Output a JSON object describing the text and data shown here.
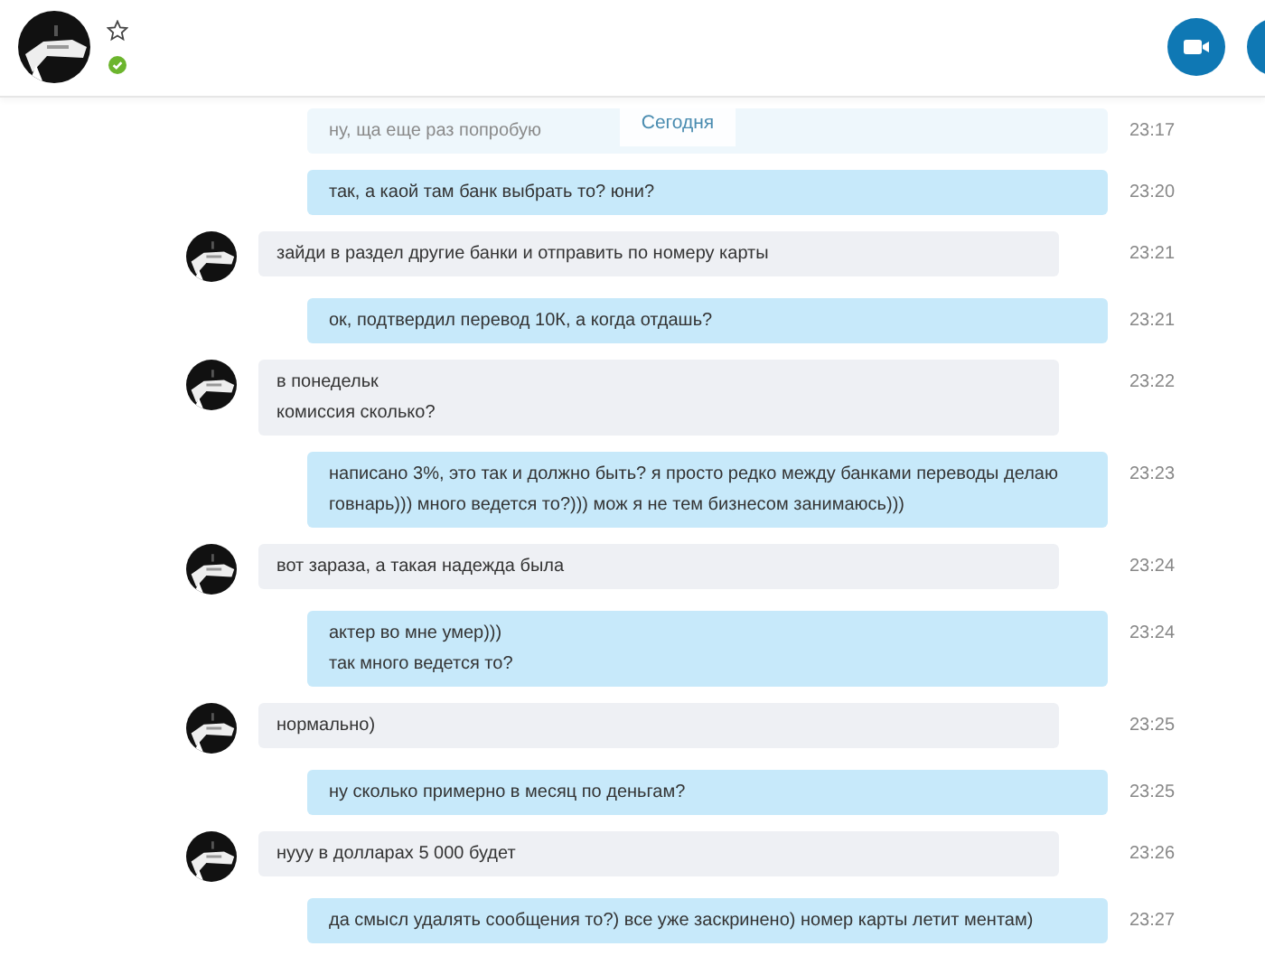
{
  "header": {
    "favorite": false,
    "online": true
  },
  "date_label": "Сегодня",
  "messages": [
    {
      "kind": "outgoing",
      "faded": true,
      "lines": [
        "ну, ща еще раз попробую"
      ],
      "time": "23:17"
    },
    {
      "kind": "outgoing",
      "faded": false,
      "lines": [
        "так, а каой там банк выбрать то? юни?"
      ],
      "time": "23:20"
    },
    {
      "kind": "incoming",
      "faded": false,
      "lines": [
        "зайди в раздел другие банки и отправить по номеру карты"
      ],
      "time": "23:21"
    },
    {
      "kind": "outgoing",
      "faded": false,
      "lines": [
        "ок, подтвердил перевод 10К, а когда отдашь?"
      ],
      "time": "23:21"
    },
    {
      "kind": "incoming",
      "faded": false,
      "lines": [
        "в понедельк",
        "комиссия сколько?"
      ],
      "time": "23:22"
    },
    {
      "kind": "outgoing",
      "faded": false,
      "lines": [
        "написано 3%, это так и должно быть? я просто редко между банками переводы делаю",
        "говнарь))) много ведется то?))) мож я не тем бизнесом занимаюсь)))"
      ],
      "time": "23:23"
    },
    {
      "kind": "incoming",
      "faded": false,
      "lines": [
        "вот зараза,  а такая надежда была"
      ],
      "time": "23:24"
    },
    {
      "kind": "outgoing",
      "faded": false,
      "lines": [
        "актер во мне умер)))",
        "так много ведется то?"
      ],
      "time": "23:24"
    },
    {
      "kind": "incoming",
      "faded": false,
      "lines": [
        "нормально)"
      ],
      "time": "23:25"
    },
    {
      "kind": "outgoing",
      "faded": false,
      "lines": [
        "ну сколько примерно в месяц по деньгам?"
      ],
      "time": "23:25"
    },
    {
      "kind": "incoming",
      "faded": false,
      "lines": [
        "нууу в долларах 5 000 будет"
      ],
      "time": "23:26"
    },
    {
      "kind": "outgoing",
      "faded": false,
      "lines": [
        "да смысл удалять сообщения то?) все уже заскринено) номер карты летит ментам)"
      ],
      "time": "23:27"
    }
  ]
}
